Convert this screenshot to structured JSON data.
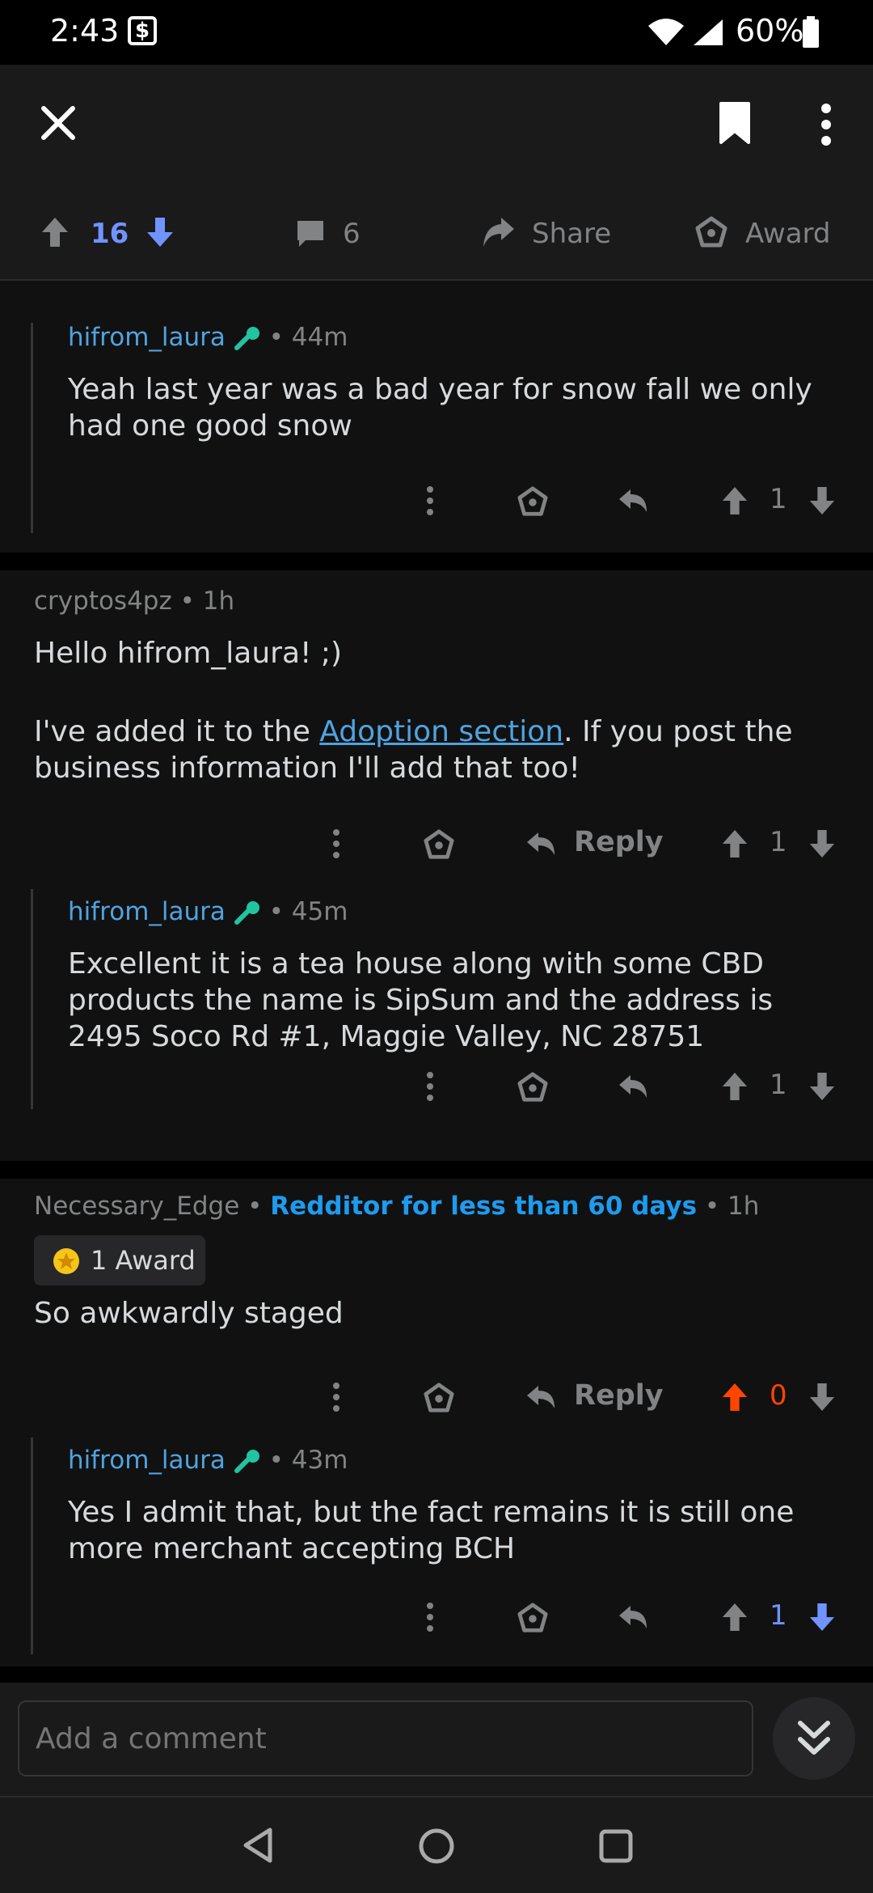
{
  "status_bar": {
    "time": "2:43",
    "battery": "60%"
  },
  "post_actions": {
    "score": "16",
    "comments": "6",
    "share": "Share",
    "award": "Award"
  },
  "comments": [
    {
      "author": "hifrom_laura",
      "age": "44m",
      "body": "Yeah last year was a bad year for snow fall we only had one good snow",
      "score": "1"
    },
    {
      "author": "cryptos4pz",
      "age": "1h",
      "body_line1": "Hello hifrom_laura! ;)",
      "body_pre": "I've added it to the ",
      "body_link": "Adoption section",
      "body_post": ". If you post the business information I'll add that too!",
      "reply": "Reply",
      "score": "1"
    },
    {
      "author": "hifrom_laura",
      "age": "45m",
      "body": "Excellent it is a tea house along with some CBD products the name is SipSum and the address is 2495 Soco Rd #1, Maggie Valley, NC 28751",
      "score": "1"
    },
    {
      "author": "Necessary_Edge",
      "flair": "Redditor for less than 60 days",
      "age": "1h",
      "award": "1 Award",
      "body": "So awkwardly staged",
      "reply": "Reply",
      "score": "0"
    },
    {
      "author": "hifrom_laura",
      "age": "43m",
      "body": "Yes I admit that, but the fact remains it is still one more merchant accepting BCH",
      "score": "1"
    }
  ],
  "composer": {
    "placeholder": "Add a comment"
  },
  "colors": {
    "upvote": "#ff4500",
    "downvote": "#7193ff",
    "link": "#4fa3e0",
    "bg": "#111111"
  }
}
